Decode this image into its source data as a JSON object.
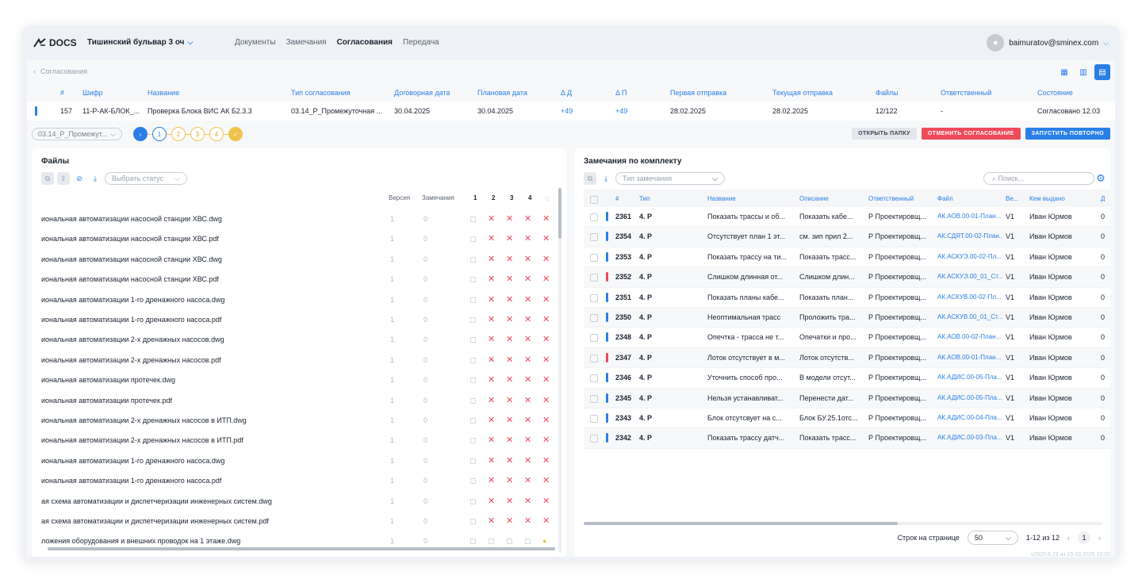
{
  "app": {
    "logo": "DOCS",
    "project": "Тишинский бульвар 3 оч",
    "user_email": "baimuratov@sminex.com"
  },
  "nav": [
    "Документы",
    "Замечания",
    "Согласования",
    "Передача"
  ],
  "nav_active": 2,
  "breadcrumb": "Согласования",
  "main_table": {
    "headers": [
      "#",
      "Шифр",
      "Название",
      "Тип согласования",
      "Договорная дата",
      "Плановая дата",
      "Δ Д",
      "Δ П",
      "Первая отправка",
      "Текущая отправка",
      "Файлы",
      "Ответственный",
      "Состояние"
    ],
    "row": [
      "157",
      "11-Р-АК-БЛОК_...",
      "Проверка Блока ВИС АК Б2.3.3",
      "03.14_Р_Промежуточная ...",
      "30.04.2025",
      "30.04.2025",
      "+49",
      "+49",
      "28.02.2025",
      "28.02.2025",
      "12/122",
      "-",
      "Согласовано 12.03"
    ]
  },
  "stage": {
    "type_value": "03.14_Р_Промежут...",
    "steps": [
      "1",
      "2",
      "3",
      "4"
    ],
    "buttons": {
      "open_folder": "ОТКРЫТЬ ПАПКУ",
      "cancel": "ОТМЕНИТЬ СОГЛАСОВАНИЕ",
      "restart": "ЗАПУСТИТЬ ПОВТОРНО"
    }
  },
  "files_panel": {
    "title": "Файлы",
    "status_placeholder": "Выбрать статус",
    "headers": {
      "version": "Версия",
      "remarks": "Замечания",
      "c1": "1",
      "c2": "2",
      "c3": "3",
      "c4": "4"
    },
    "rows": [
      {
        "name": "иональная автоматизации насосной станции ХВС.dwg",
        "version": "1",
        "remarks": "0"
      },
      {
        "name": "иональная автоматизации насосной станции ХВС.pdf",
        "version": "1",
        "remarks": "0"
      },
      {
        "name": "иональная автоматизации насосной станции ХВС.dwg",
        "version": "1",
        "remarks": "0"
      },
      {
        "name": "иональная автоматизации насосной станции ХВС.pdf",
        "version": "1",
        "remarks": "0"
      },
      {
        "name": "иональная автоматизации 1-го дренажного насоса.dwg",
        "version": "1",
        "remarks": "0"
      },
      {
        "name": "иональная автоматизации 1-го дренажного насоса.pdf",
        "version": "1",
        "remarks": "0"
      },
      {
        "name": "иональная автоматизации 2-х дренажных насосов.dwg",
        "version": "1",
        "remarks": "0"
      },
      {
        "name": "иональная автоматизации 2-х дренажных насосов.pdf",
        "version": "1",
        "remarks": "0"
      },
      {
        "name": "иональная автоматизации протечек.dwg",
        "version": "1",
        "remarks": "0"
      },
      {
        "name": "иональная автоматизации протечек.pdf",
        "version": "1",
        "remarks": "0"
      },
      {
        "name": "иональная автоматизации 2-х дренажных насосов в ИТП.dwg",
        "version": "1",
        "remarks": "0"
      },
      {
        "name": "иональная автоматизации 2-х дренажных насосов в ИТП.pdf",
        "version": "1",
        "remarks": "0"
      },
      {
        "name": "иональная автоматизации 1-го дренажного насоса.dwg",
        "version": "1",
        "remarks": "0"
      },
      {
        "name": "иональная автоматизации 1-го дренажного насоса.pdf",
        "version": "1",
        "remarks": "0"
      },
      {
        "name": "ая схема автоматизации и диспетчеризации инженерных систем.dwg",
        "version": "1",
        "remarks": "0"
      },
      {
        "name": "ая схема автоматизации и диспетчеризации инженерных систем.pdf",
        "version": "1",
        "remarks": "0"
      },
      {
        "name": "ложения оборудования и внешних проводок на 1 этаже.dwg",
        "version": "1",
        "remarks": "0"
      }
    ]
  },
  "remarks_panel": {
    "title": "Замечания по комплекту",
    "type_placeholder": "Тип замечания",
    "search_placeholder": "Поиск...",
    "headers": [
      "#",
      "Тип",
      "Название",
      "Описание",
      "Ответственный",
      "Файл",
      "Ве...",
      "Кем выдано",
      "Д"
    ],
    "rows": [
      {
        "id": "2361",
        "type": "4. Р",
        "title": "Показать трассы и об...",
        "desc": "Показать кабе...",
        "resp": "Р Проектировщ...",
        "file": "АК.АОВ.00-01-План...",
        "ver": "V1",
        "by": "Иван Юрмов",
        "d": "0",
        "color": "#2a7fe6"
      },
      {
        "id": "2354",
        "type": "4. Р",
        "title": "Отсутствует план 1 эт...",
        "desc": "см. зип прил 2...",
        "resp": "Р Проектировщ...",
        "file": "АК.СДЯТ.00-02-План...",
        "ver": "V1",
        "by": "Иван Юрмов",
        "d": "0",
        "color": "#2a7fe6"
      },
      {
        "id": "2353",
        "type": "4. Р",
        "title": "Показать трассу на ти...",
        "desc": "Показать трасс...",
        "resp": "Р Проектировщ...",
        "file": "АК.АСКУЭ.00-02-Пл...",
        "ver": "V1",
        "by": "Иван Юрмов",
        "d": "0",
        "color": "#2a7fe6"
      },
      {
        "id": "2352",
        "type": "4. Р",
        "title": "Слишком длинная от...",
        "desc": "Слишком длин...",
        "resp": "Р Проектировщ...",
        "file": "АК.АСКУЭ.00_01_Ст...",
        "ver": "V1",
        "by": "Иван Юрмов",
        "d": "0",
        "color": "#ee4a5a"
      },
      {
        "id": "2351",
        "type": "4. Р",
        "title": "Показать планы кабе...",
        "desc": "Показать план...",
        "resp": "Р Проектировщ...",
        "file": "АК.АСКУВ.00-02-Пл...",
        "ver": "V1",
        "by": "Иван Юрмов",
        "d": "0",
        "color": "#2a7fe6"
      },
      {
        "id": "2350",
        "type": "4. Р",
        "title": "Неоптимальная трасс",
        "desc": "Проложить тра...",
        "resp": "Р Проектировщ...",
        "file": "АК.АСКУВ.00_01_Ст...",
        "ver": "V1",
        "by": "Иван Юрмов",
        "d": "0",
        "color": "#2a7fe6"
      },
      {
        "id": "2348",
        "type": "4. Р",
        "title": "Опечтка - трасса не т...",
        "desc": "Опечатки и про...",
        "resp": "Р Проектировщ...",
        "file": "АК.АОВ.00-02-План...",
        "ver": "V1",
        "by": "Иван Юрмов",
        "d": "0",
        "color": "#2a7fe6"
      },
      {
        "id": "2347",
        "type": "4. Р",
        "title": "Лоток отсутствует в м...",
        "desc": "Лоток отсутств...",
        "resp": "Р Проектировщ...",
        "file": "АК.АОВ.00-01-План...",
        "ver": "V1",
        "by": "Иван Юрмов",
        "d": "0",
        "color": "#ee4a5a"
      },
      {
        "id": "2346",
        "type": "4. Р",
        "title": "Уточнить способ про...",
        "desc": "В модели отсут...",
        "resp": "Р Проектировщ...",
        "file": "АК.АДИС.00-05-Пла...",
        "ver": "V1",
        "by": "Иван Юрмов",
        "d": "0",
        "color": "#2a7fe6"
      },
      {
        "id": "2345",
        "type": "4. Р",
        "title": "Нельзя устанавливат...",
        "desc": "Перенести дат...",
        "resp": "Р Проектировщ...",
        "file": "АК.АДИС.00-05-Пла...",
        "ver": "V1",
        "by": "Иван Юрмов",
        "d": "0",
        "color": "#2a7fe6"
      },
      {
        "id": "2343",
        "type": "4. Р",
        "title": "Блок отсутсвует на с...",
        "desc": "Блок БУ.25.1отс...",
        "resp": "Р Проектировщ...",
        "file": "АК.АДИС.00-04-Пла...",
        "ver": "V1",
        "by": "Иван Юрмов",
        "d": "0",
        "color": "#2a7fe6"
      },
      {
        "id": "2342",
        "type": "4. Р",
        "title": "Показать трассу датч...",
        "desc": "Показать трасс...",
        "resp": "Р Проектировщ...",
        "file": "АК.АДИС.00-03-Пла...",
        "ver": "V1",
        "by": "Иван Юрмов",
        "d": "0",
        "color": "#2a7fe6"
      }
    ],
    "pager": {
      "label": "Строк на странице",
      "size": "50",
      "range": "1-12 из 12",
      "page": "1"
    }
  },
  "version_text": "v2025.8.23 из 19.03.2025 22:07"
}
